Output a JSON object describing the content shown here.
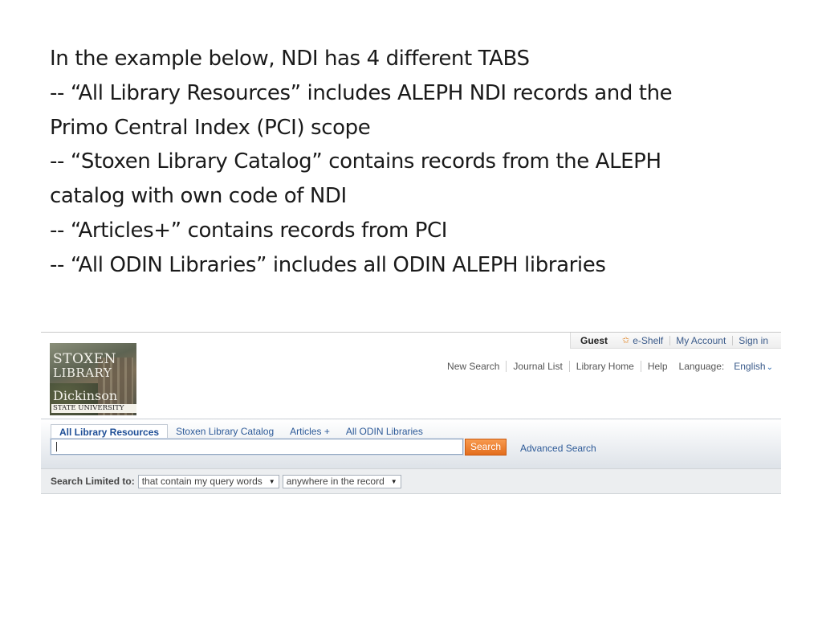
{
  "slide": {
    "lines": [
      "In the example below, NDI has 4 different TABS",
      "-- “All Library Resources” includes ALEPH NDI records and the",
      "Primo Central Index (PCI) scope",
      "-- “Stoxen Library Catalog” contains records from the ALEPH",
      "catalog with own code of NDI",
      "-- “Articles+” contains records from PCI",
      "-- “All ODIN Libraries” includes all ODIN ALEPH libraries"
    ]
  },
  "userbar": {
    "guest": "Guest",
    "eshelf": "e-Shelf",
    "my_account": "My Account",
    "sign_in": "Sign in"
  },
  "logo": {
    "line1": "STOXEN",
    "line1b": "LIBRARY",
    "line2": "Dickinson",
    "line3": "STATE UNIVERSITY"
  },
  "mainnav": {
    "new_search": "New Search",
    "journal_list": "Journal List",
    "library_home": "Library Home",
    "help": "Help",
    "language_label": "Language:",
    "language": "English"
  },
  "tabs": [
    {
      "label": "All Library Resources",
      "active": true
    },
    {
      "label": "Stoxen Library Catalog",
      "active": false
    },
    {
      "label": "Articles +",
      "active": false
    },
    {
      "label": "All ODIN Libraries",
      "active": false
    }
  ],
  "search": {
    "value": "",
    "button": "Search",
    "advanced": "Advanced Search"
  },
  "limit": {
    "label": "Search Limited to:",
    "precision": "that contain my query words",
    "scope": "anywhere in the record"
  },
  "colors": {
    "link": "#2d5a98",
    "search_button": "#f07f2a"
  }
}
